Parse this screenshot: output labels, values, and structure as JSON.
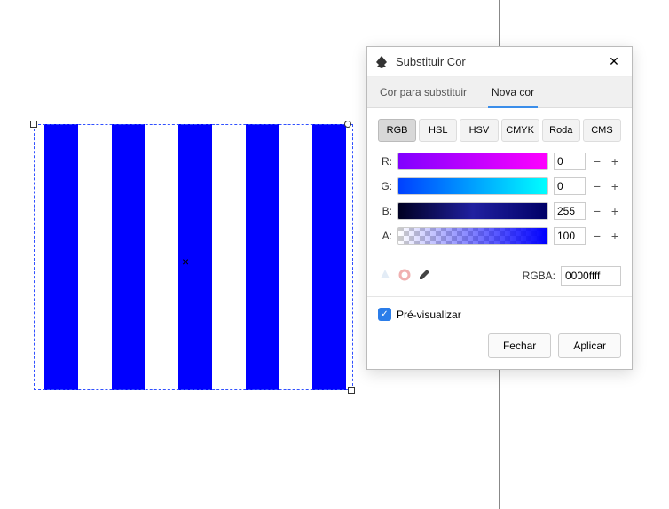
{
  "dialog": {
    "title": "Substituir Cor",
    "tabs": {
      "replace": "Cor para substituir",
      "new": "Nova cor"
    },
    "modes": {
      "rgb": "RGB",
      "hsl": "HSL",
      "hsv": "HSV",
      "cmyk": "CMYK",
      "wheel": "Roda",
      "cms": "CMS"
    },
    "channels": {
      "r": {
        "label": "R:",
        "value": "0"
      },
      "g": {
        "label": "G:",
        "value": "0"
      },
      "b": {
        "label": "B:",
        "value": "255"
      },
      "a": {
        "label": "A:",
        "value": "100"
      }
    },
    "rgba": {
      "label": "RGBA:",
      "value": "0000ffff"
    },
    "preview": "Pré-visualizar",
    "buttons": {
      "close": "Fechar",
      "apply": "Aplicar"
    }
  }
}
